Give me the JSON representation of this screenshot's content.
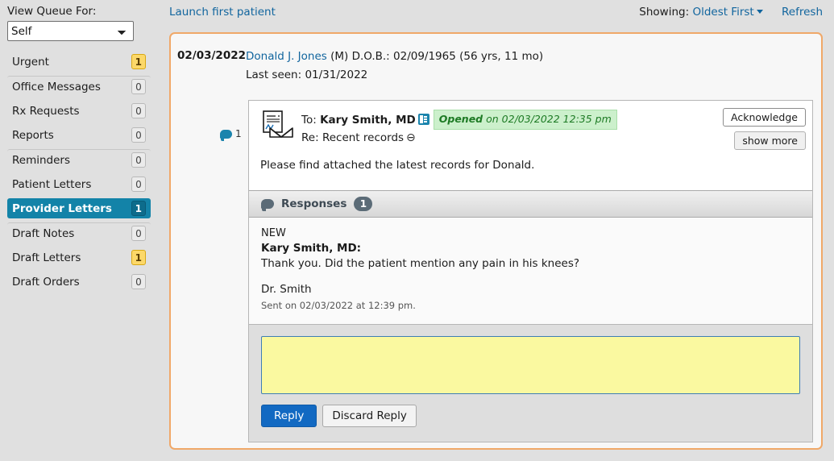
{
  "sidebar": {
    "queue_label": "View Queue For:",
    "queue_select": {
      "value": "Self",
      "options": [
        "Self"
      ]
    },
    "items": [
      {
        "label": "Urgent",
        "count": "1",
        "style": "warn",
        "active": false,
        "separator_after": true
      },
      {
        "label": "Office Messages",
        "count": "0",
        "style": "default",
        "active": false,
        "separator_after": false
      },
      {
        "label": "Rx Requests",
        "count": "0",
        "style": "default",
        "active": false,
        "separator_after": false
      },
      {
        "label": "Reports",
        "count": "0",
        "style": "default",
        "active": false,
        "separator_after": true
      },
      {
        "label": "Reminders",
        "count": "0",
        "style": "default",
        "active": false,
        "separator_after": false
      },
      {
        "label": "Patient Letters",
        "count": "0",
        "style": "default",
        "active": false,
        "separator_after": false
      },
      {
        "label": "Provider Letters",
        "count": "1",
        "style": "active",
        "active": true,
        "separator_after": true
      },
      {
        "label": "Draft Notes",
        "count": "0",
        "style": "default",
        "active": false,
        "separator_after": false
      },
      {
        "label": "Draft Letters",
        "count": "1",
        "style": "warn",
        "active": false,
        "separator_after": false
      },
      {
        "label": "Draft Orders",
        "count": "0",
        "style": "default",
        "active": false,
        "separator_after": false
      }
    ]
  },
  "topbar": {
    "launch_link": "Launch first patient",
    "showing_label": "Showing:",
    "sort_value": "Oldest First",
    "refresh_label": "Refresh"
  },
  "patient": {
    "date": "02/03/2022",
    "name": "Donald J. Jones",
    "demographics": "(M)  D.O.B.: 02/09/1965 (56 yrs, 11 mo)",
    "last_seen": "Last seen: 01/31/2022",
    "message_count": "1"
  },
  "message": {
    "to_prefix": "To:",
    "to_name": "Kary Smith, MD",
    "status_word": "Opened",
    "status_rest": " on 02/03/2022 12:35 pm",
    "re_prefix": "Re:",
    "re_subject": "Recent records",
    "attachment_glyph": "⊖",
    "acknowledge_label": "Acknowledge",
    "show_more_label": "show more",
    "body": "Please find attached the latest records for Donald."
  },
  "responses": {
    "title": "Responses",
    "count": "1",
    "items": [
      {
        "status": "NEW",
        "author": "Kary Smith, MD:",
        "text": "Thank you. Did the patient mention any pain in his knees?",
        "signature": "Dr. Smith",
        "sent": "Sent on 02/03/2022 at 12:39 pm."
      }
    ]
  },
  "reply": {
    "value": "",
    "placeholder": "",
    "reply_label": "Reply",
    "discard_label": "Discard Reply"
  },
  "colors": {
    "accent_blue": "#1383a8",
    "link_blue": "#11659e",
    "warn_yellow": "#fcd869",
    "card_orange": "#f0a868",
    "opened_green": "#ccf0cc",
    "reply_yellow": "#faf9a0",
    "primary_button": "#1269c2"
  }
}
